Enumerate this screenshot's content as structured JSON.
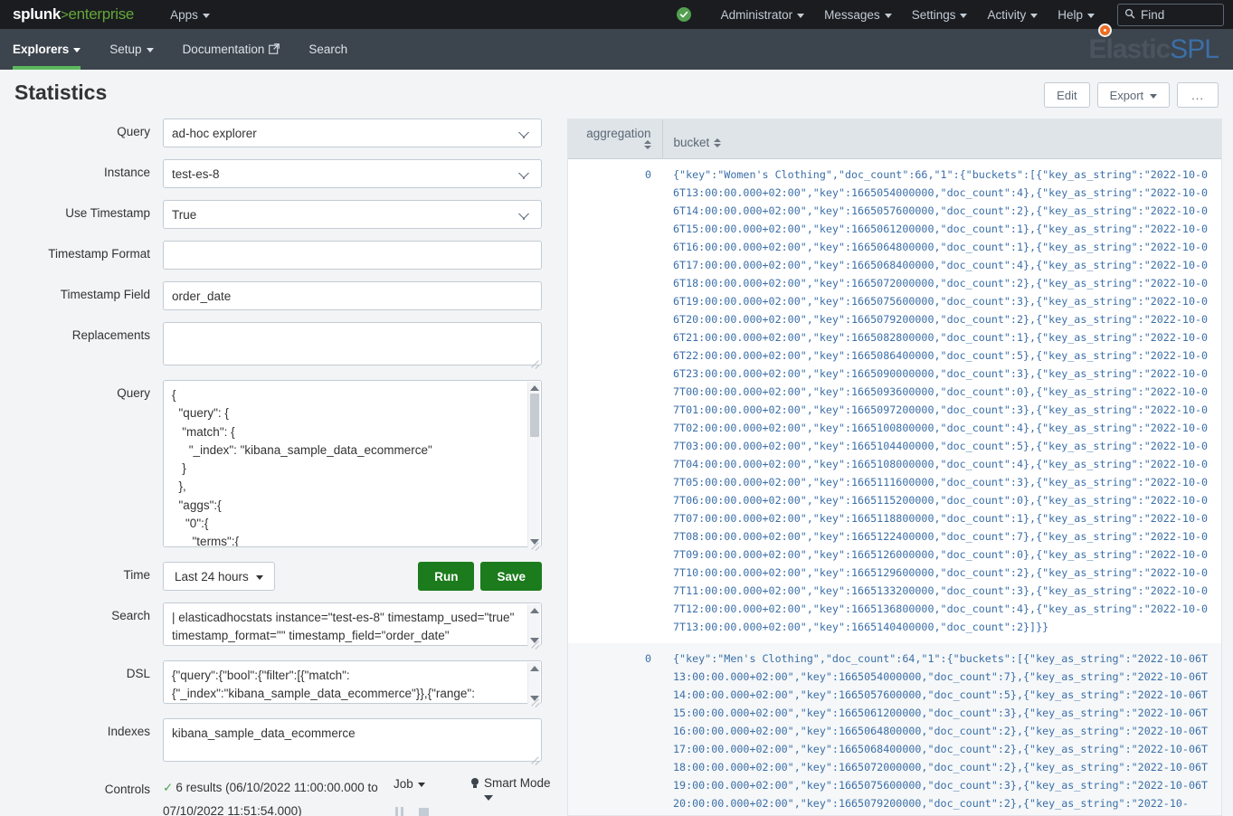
{
  "topbar": {
    "logo": {
      "splunk": "splunk",
      "gt": ">",
      "enterprise": "enterprise"
    },
    "apps_label": "Apps",
    "status_icon": "check-circle-icon",
    "items": [
      {
        "label": "Administrator",
        "caret": true
      },
      {
        "label": "Messages",
        "caret": true
      },
      {
        "label": "Settings",
        "caret": true
      },
      {
        "label": "Activity",
        "caret": true
      },
      {
        "label": "Help",
        "caret": true
      }
    ],
    "find": {
      "icon": "search-icon",
      "placeholder": "Find",
      "value": "Find"
    }
  },
  "appnav": {
    "items": [
      {
        "label": "Explorers",
        "caret": true,
        "active": true
      },
      {
        "label": "Setup",
        "caret": true,
        "active": false
      },
      {
        "label": "Documentation",
        "external": true,
        "active": false
      },
      {
        "label": "Search",
        "active": false
      }
    ],
    "brand": {
      "part1": "Elastic",
      "part2": "SPL",
      "dot_color": "#ef6c23"
    }
  },
  "page": {
    "title": "Statistics",
    "actions": {
      "edit": "Edit",
      "export": "Export",
      "more": "..."
    }
  },
  "form": {
    "query_select": {
      "label": "Query",
      "value": "ad-hoc explorer"
    },
    "instance": {
      "label": "Instance",
      "value": "test-es-8"
    },
    "use_timestamp": {
      "label": "Use Timestamp",
      "value": "True"
    },
    "timestamp_format": {
      "label": "Timestamp Format",
      "value": ""
    },
    "timestamp_field": {
      "label": "Timestamp Field",
      "value": "order_date"
    },
    "replacements": {
      "label": "Replacements",
      "value": ""
    },
    "query_body": {
      "label": "Query",
      "value": "{\n  \"query\": {\n   \"match\": {\n     \"_index\": \"kibana_sample_data_ecommerce\"\n   }\n  },\n  \"aggs\":{\n    \"0\":{\n      \"terms\":{"
    },
    "time": {
      "label": "Time",
      "value": "Last 24 hours"
    },
    "run_button": "Run",
    "save_button": "Save",
    "search": {
      "label": "Search",
      "value": "| elasticadhocstats instance=\"test-es-8\" timestamp_used=\"true\" timestamp_format=\"\" timestamp_field=\"order_date\""
    },
    "dsl": {
      "label": "DSL",
      "value": "{\"query\":{\"bool\":{\"filter\":[{\"match\": {\"_index\":\"kibana_sample_data_ecommerce\"}},{\"range\":"
    },
    "indexes": {
      "label": "Indexes",
      "value": "kibana_sample_data_ecommerce"
    },
    "controls": {
      "label": "Controls",
      "results_text": "6 results (06/10/2022 11:00:00.000 to 07/10/2022 11:51:54.000)",
      "job_label": "Job",
      "pause_icon": "pause-icon",
      "stop_icon": "stop-icon",
      "mode_label": "Smart Mode",
      "mode_icon": "lightbulb-icon"
    }
  },
  "results": {
    "columns": [
      {
        "key": "aggregation",
        "label": "aggregation"
      },
      {
        "key": "bucket",
        "label": "bucket"
      }
    ],
    "rows": [
      {
        "aggregation": "0",
        "bucket": "{\"key\":\"Women's Clothing\",\"doc_count\":66,\"1\":{\"buckets\":[{\"key_as_string\":\"2022-10-06T13:00:00.000+02:00\",\"key\":1665054000000,\"doc_count\":4},{\"key_as_string\":\"2022-10-06T14:00:00.000+02:00\",\"key\":1665057600000,\"doc_count\":2},{\"key_as_string\":\"2022-10-06T15:00:00.000+02:00\",\"key\":1665061200000,\"doc_count\":1},{\"key_as_string\":\"2022-10-06T16:00:00.000+02:00\",\"key\":1665064800000,\"doc_count\":1},{\"key_as_string\":\"2022-10-06T17:00:00.000+02:00\",\"key\":1665068400000,\"doc_count\":4},{\"key_as_string\":\"2022-10-06T18:00:00.000+02:00\",\"key\":1665072000000,\"doc_count\":2},{\"key_as_string\":\"2022-10-06T19:00:00.000+02:00\",\"key\":1665075600000,\"doc_count\":3},{\"key_as_string\":\"2022-10-06T20:00:00.000+02:00\",\"key\":1665079200000,\"doc_count\":2},{\"key_as_string\":\"2022-10-06T21:00:00.000+02:00\",\"key\":1665082800000,\"doc_count\":1},{\"key_as_string\":\"2022-10-06T22:00:00.000+02:00\",\"key\":1665086400000,\"doc_count\":5},{\"key_as_string\":\"2022-10-06T23:00:00.000+02:00\",\"key\":1665090000000,\"doc_count\":3},{\"key_as_string\":\"2022-10-07T00:00:00.000+02:00\",\"key\":1665093600000,\"doc_count\":0},{\"key_as_string\":\"2022-10-07T01:00:00.000+02:00\",\"key\":1665097200000,\"doc_count\":3},{\"key_as_string\":\"2022-10-07T02:00:00.000+02:00\",\"key\":1665100800000,\"doc_count\":4},{\"key_as_string\":\"2022-10-07T03:00:00.000+02:00\",\"key\":1665104400000,\"doc_count\":5},{\"key_as_string\":\"2022-10-07T04:00:00.000+02:00\",\"key\":1665108000000,\"doc_count\":4},{\"key_as_string\":\"2022-10-07T05:00:00.000+02:00\",\"key\":1665111600000,\"doc_count\":3},{\"key_as_string\":\"2022-10-07T06:00:00.000+02:00\",\"key\":1665115200000,\"doc_count\":0},{\"key_as_string\":\"2022-10-07T07:00:00.000+02:00\",\"key\":1665118800000,\"doc_count\":1},{\"key_as_string\":\"2022-10-07T08:00:00.000+02:00\",\"key\":1665122400000,\"doc_count\":7},{\"key_as_string\":\"2022-10-07T09:00:00.000+02:00\",\"key\":1665126000000,\"doc_count\":0},{\"key_as_string\":\"2022-10-07T10:00:00.000+02:00\",\"key\":1665129600000,\"doc_count\":2},{\"key_as_string\":\"2022-10-07T11:00:00.000+02:00\",\"key\":1665133200000,\"doc_count\":3},{\"key_as_string\":\"2022-10-07T12:00:00.000+02:00\",\"key\":1665136800000,\"doc_count\":4},{\"key_as_string\":\"2022-10-07T13:00:00.000+02:00\",\"key\":1665140400000,\"doc_count\":2}]}}"
      },
      {
        "aggregation": "0",
        "bucket": "{\"key\":\"Men's Clothing\",\"doc_count\":64,\"1\":{\"buckets\":[{\"key_as_string\":\"2022-10-06T13:00:00.000+02:00\",\"key\":1665054000000,\"doc_count\":7},{\"key_as_string\":\"2022-10-06T14:00:00.000+02:00\",\"key\":1665057600000,\"doc_count\":5},{\"key_as_string\":\"2022-10-06T15:00:00.000+02:00\",\"key\":1665061200000,\"doc_count\":3},{\"key_as_string\":\"2022-10-06T16:00:00.000+02:00\",\"key\":1665064800000,\"doc_count\":2},{\"key_as_string\":\"2022-10-06T17:00:00.000+02:00\",\"key\":1665068400000,\"doc_count\":2},{\"key_as_string\":\"2022-10-06T18:00:00.000+02:00\",\"key\":1665072000000,\"doc_count\":2},{\"key_as_string\":\"2022-10-06T19:00:00.000+02:00\",\"key\":1665075600000,\"doc_count\":3},{\"key_as_string\":\"2022-10-06T20:00:00.000+02:00\",\"key\":1665079200000,\"doc_count\":2},{\"key_as_string\":\"2022-10-"
      }
    ]
  }
}
